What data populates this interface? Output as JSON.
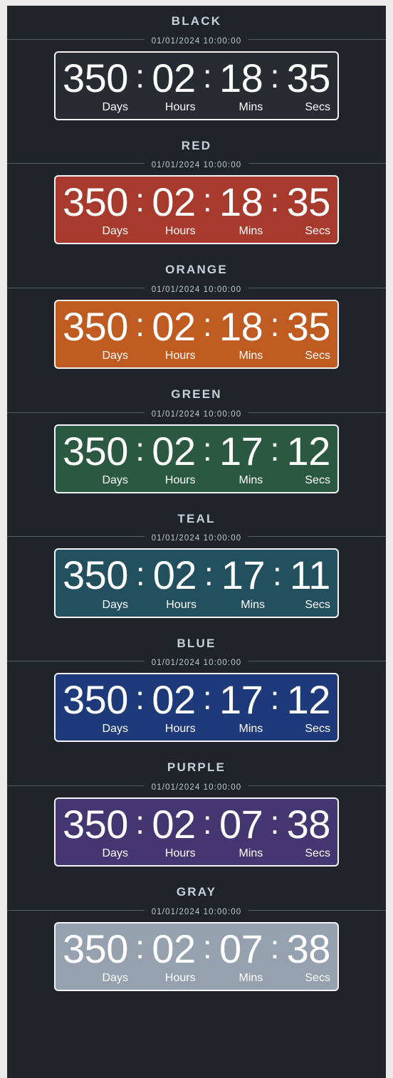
{
  "page": {
    "background_color": "#1f242a",
    "frame_color": "#ebebeb",
    "rule_color": "#555c64",
    "title_color": "#c9d0d8",
    "card_border_color": "#f2f4f6",
    "digit_color": "#ffffff"
  },
  "labels": {
    "days": "Days",
    "hours": "Hours",
    "mins": "Mins",
    "secs": "Secs",
    "separator": ":"
  },
  "sections": [
    {
      "title": "BLACK",
      "timestamp": "01/01/2024 10:00:00",
      "color_hex": "#272c32",
      "days": "350",
      "hours": "02",
      "mins": "18",
      "secs": "35"
    },
    {
      "title": "RED",
      "timestamp": "01/01/2024 10:00:00",
      "color_hex": "#a73a2c",
      "days": "350",
      "hours": "02",
      "mins": "18",
      "secs": "35"
    },
    {
      "title": "ORANGE",
      "timestamp": "01/01/2024 10:00:00",
      "color_hex": "#bf5b21",
      "days": "350",
      "hours": "02",
      "mins": "18",
      "secs": "35"
    },
    {
      "title": "GREEN",
      "timestamp": "01/01/2024 10:00:00",
      "color_hex": "#2a5840",
      "days": "350",
      "hours": "02",
      "mins": "17",
      "secs": "12"
    },
    {
      "title": "TEAL",
      "timestamp": "01/01/2024 10:00:00",
      "color_hex": "#23505f",
      "days": "350",
      "hours": "02",
      "mins": "17",
      "secs": "11"
    },
    {
      "title": "BLUE",
      "timestamp": "01/01/2024 10:00:00",
      "color_hex": "#1e3a7a",
      "days": "350",
      "hours": "02",
      "mins": "17",
      "secs": "12"
    },
    {
      "title": "PURPLE",
      "timestamp": "01/01/2024 10:00:00",
      "color_hex": "#443670",
      "days": "350",
      "hours": "02",
      "mins": "07",
      "secs": "38"
    },
    {
      "title": "GRAY",
      "timestamp": "01/01/2024 10:00:00",
      "color_hex": "#95a1ae",
      "days": "350",
      "hours": "02",
      "mins": "07",
      "secs": "38"
    }
  ]
}
